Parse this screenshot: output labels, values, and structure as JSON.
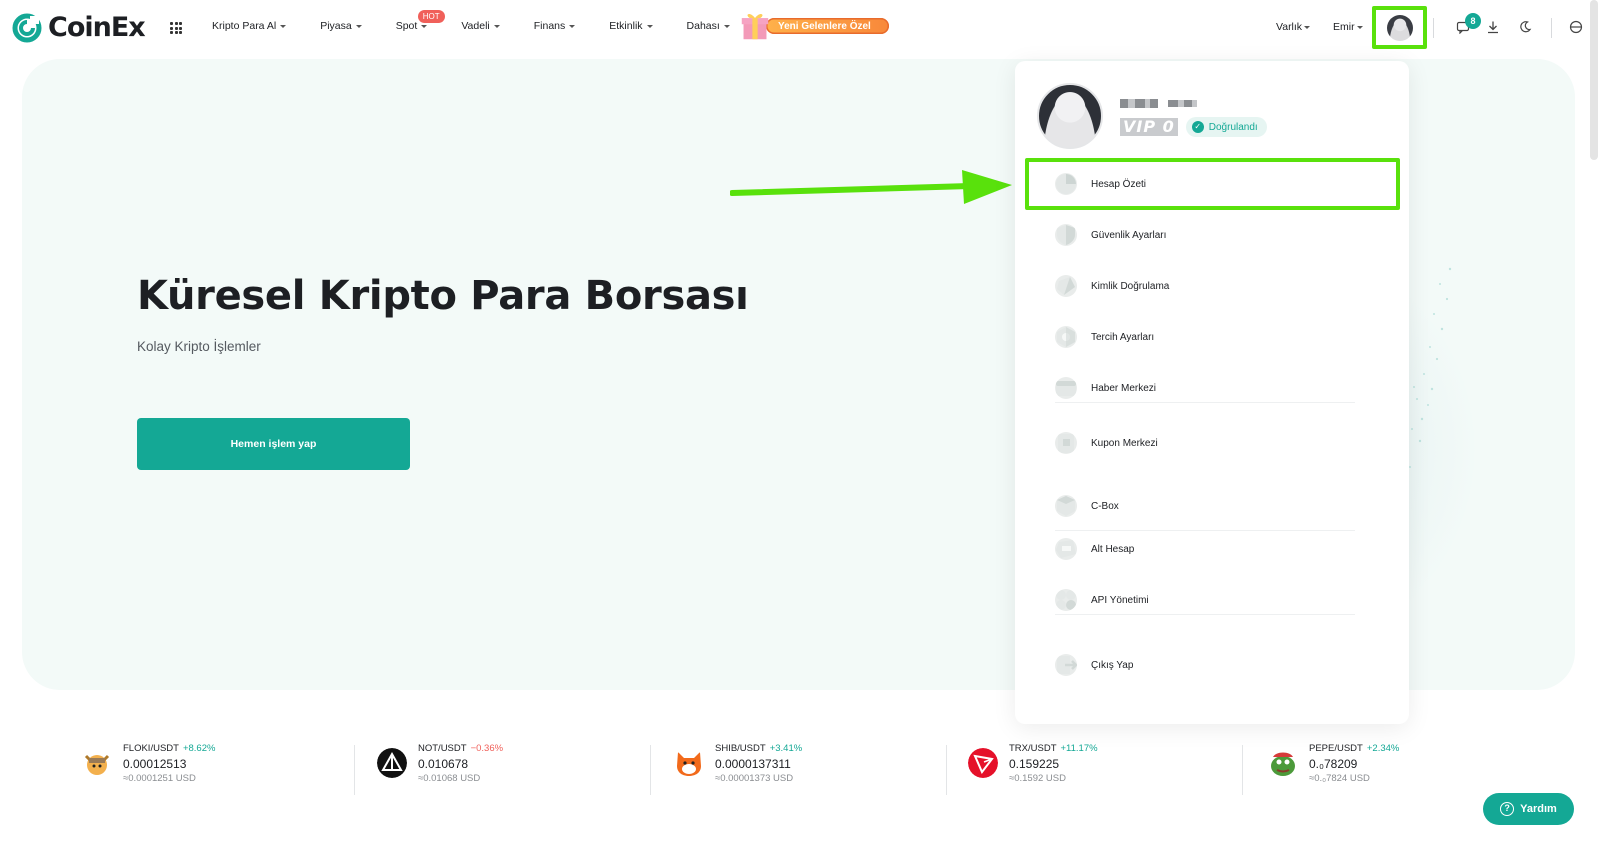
{
  "brand": {
    "name": "CoinEx",
    "accent": "#14a895",
    "highlight": "#59e10c"
  },
  "nav": {
    "menu": [
      {
        "label": "Kripto Para Al"
      },
      {
        "label": "Piyasa"
      },
      {
        "label": "Spot",
        "badge": "HOT"
      },
      {
        "label": "Vadeli"
      },
      {
        "label": "Finans"
      },
      {
        "label": "Etkinlik"
      },
      {
        "label": "Dahası"
      }
    ],
    "promo_label": "Yeni Gelenlere Özel",
    "right": {
      "assets": "Varlık",
      "orders": "Emir",
      "notifications_count": "8"
    }
  },
  "hero": {
    "title": "Küresel Kripto Para Borsası",
    "subtitle": "Kolay Kripto İşlemler",
    "cta": "Hemen işlem yap"
  },
  "profile": {
    "vip": "VIP 0",
    "verified": "Doğrulandı",
    "items": [
      {
        "label": "Hesap Özeti",
        "icon": "pie-chart-icon"
      },
      {
        "label": "Güvenlik Ayarları",
        "icon": "shield-icon"
      },
      {
        "label": "Kimlik Doğrulama",
        "icon": "id-card-icon"
      },
      {
        "label": "Tercih Ayarları",
        "icon": "gear-icon"
      },
      {
        "label": "Haber Merkezi",
        "icon": "message-icon"
      },
      {
        "label": "Kupon Merkezi",
        "icon": "coupon-icon"
      },
      {
        "label": "C-Box",
        "icon": "box-icon"
      },
      {
        "label": "Alt Hesap",
        "icon": "sub-account-icon"
      },
      {
        "label": "API Yönetimi",
        "icon": "api-icon"
      },
      {
        "label": "Çıkış Yap",
        "icon": "logout-icon"
      }
    ]
  },
  "ticker": [
    {
      "pair": "FLOKI/USDT",
      "change": "+8.62%",
      "dir": "up",
      "price": "0.00012513",
      "usd": "≈0.0001251 USD",
      "color": "#f0a63a"
    },
    {
      "pair": "NOT/USDT",
      "change": "−0.36%",
      "dir": "down",
      "price": "0.010678",
      "usd": "≈0.01068 USD",
      "color": "#111111"
    },
    {
      "pair": "SHIB/USDT",
      "change": "+3.41%",
      "dir": "up",
      "price": "0.0000137311",
      "usd": "≈0.00001373 USD",
      "color": "#f26a1b"
    },
    {
      "pair": "TRX/USDT",
      "change": "+11.17%",
      "dir": "up",
      "price": "0.159225",
      "usd": "≈0.1592 USD",
      "color": "#e5112a"
    },
    {
      "pair": "PEPE/USDT",
      "change": "+2.34%",
      "dir": "up",
      "price": "0.₀78209",
      "usd": "≈0.₀7824 USD",
      "color": "#4c9a3a"
    }
  ],
  "help": {
    "label": "Yardım"
  }
}
